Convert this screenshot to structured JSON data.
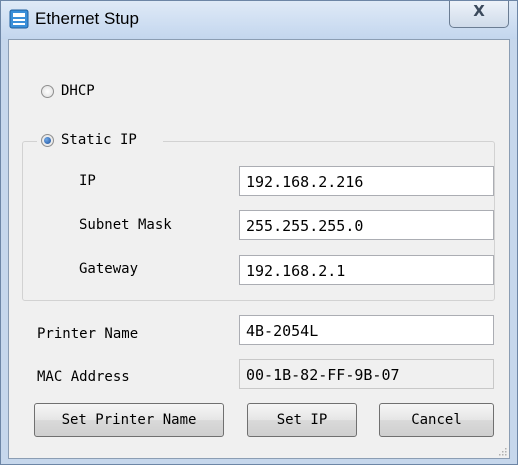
{
  "window": {
    "title": "Ethernet Stup",
    "close_label": "X"
  },
  "mode": {
    "dhcp_label": "DHCP",
    "static_label": "Static IP",
    "selected": "Static IP"
  },
  "static_ip": {
    "ip_label": "IP",
    "ip_value": "192.168.2.216",
    "subnet_label": "Subnet Mask",
    "subnet_value": "255.255.255.0",
    "gateway_label": "Gateway",
    "gateway_value": "192.168.2.1"
  },
  "printer": {
    "name_label": "Printer Name",
    "name_value": "4B-2054L",
    "mac_label": "MAC Address",
    "mac_value": "00-1B-82-FF-9B-07"
  },
  "buttons": {
    "set_name": "Set Printer Name",
    "set_ip": "Set IP",
    "cancel": "Cancel"
  },
  "colors": {
    "title_bg": "#c6d7ec",
    "dialog_bg": "#f0f0f0",
    "radio_selected": "#1c4f9c"
  },
  "icons": {
    "app": "printer-icon"
  }
}
